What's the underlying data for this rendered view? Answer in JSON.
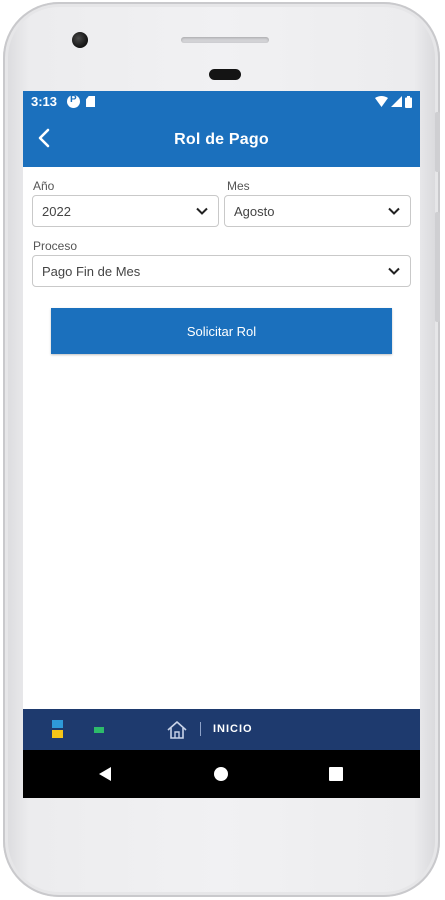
{
  "status": {
    "time": "3:13"
  },
  "appbar": {
    "title": "Rol de Pago"
  },
  "form": {
    "year": {
      "label": "Año",
      "value": "2022"
    },
    "month": {
      "label": "Mes",
      "value": "Agosto"
    },
    "process": {
      "label": "Proceso",
      "value": "Pago Fin de Mes"
    },
    "submit_label": "Solicitar Rol"
  },
  "bottom_nav": {
    "home_label": "INICIO"
  },
  "colors": {
    "primary": "#1b70bd",
    "nav_bg": "#1e3a6e",
    "system_nav": "#000000"
  },
  "icons": [
    "back-arrow-icon",
    "chevron-down-icon",
    "home-icon",
    "wifi-icon",
    "signal-icon",
    "battery-icon"
  ]
}
